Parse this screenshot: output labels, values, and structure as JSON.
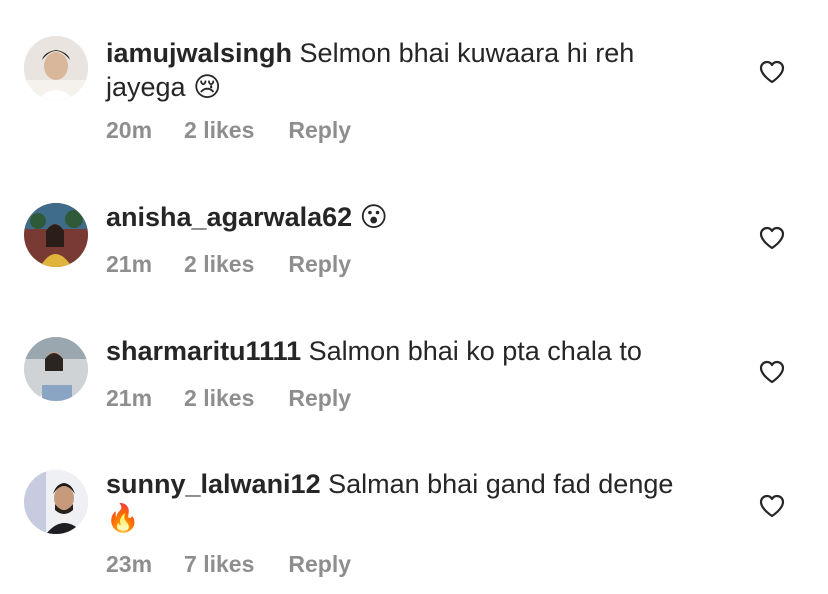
{
  "comments": [
    {
      "username": "iamujwalsingh",
      "text": " Selmon bhai kuwaara hi reh jayega",
      "emoji": "😢",
      "emoji_icon": "crying-face-icon",
      "time": "20m",
      "likes": "2 likes",
      "reply": "Reply"
    },
    {
      "username": "anisha_agarwala62",
      "text": "",
      "emoji": "😮",
      "emoji_icon": "surprised-face-icon",
      "time": "21m",
      "likes": "2 likes",
      "reply": "Reply"
    },
    {
      "username": "sharmaritu1111",
      "text": " Salmon bhai ko pta chala to",
      "emoji": "",
      "emoji_icon": "",
      "time": "21m",
      "likes": "2 likes",
      "reply": "Reply"
    },
    {
      "username": "sunny_lalwani12",
      "text": " Salman bhai gand fad denge",
      "emoji": "🔥",
      "emoji_icon": "fire-icon",
      "time": "23m",
      "likes": "7 likes",
      "reply": "Reply"
    }
  ],
  "colors": {
    "text": "#262626",
    "meta": "#8e8e8e",
    "heart_stroke": "#262626"
  }
}
